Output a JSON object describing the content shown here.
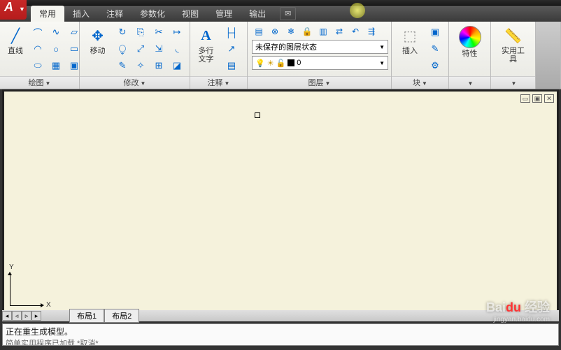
{
  "app": {
    "logo": "A"
  },
  "menubar": {
    "tabs": [
      "常用",
      "插入",
      "注释",
      "参数化",
      "视图",
      "管理",
      "输出"
    ],
    "mail_icon": "✉"
  },
  "ribbon": {
    "draw": {
      "title": "绘图",
      "line_label": "直线"
    },
    "modify": {
      "title": "修改",
      "move_label": "移动"
    },
    "annotate": {
      "title": "注释",
      "text_label": "多行\n文字"
    },
    "layers": {
      "title": "图层",
      "state": "未保存的图层状态",
      "current": "0"
    },
    "block": {
      "title": "块",
      "insert_label": "插入"
    },
    "prop": {
      "title": "特性"
    },
    "util": {
      "title": "实用工具"
    }
  },
  "layout": {
    "nav": [
      "◂",
      "◃",
      "▹",
      "▸"
    ],
    "tabs": [
      "布局1",
      "布局2"
    ]
  },
  "ucs": {
    "x": "X",
    "y": "Y"
  },
  "canvas_controls": [
    "▭",
    "▣",
    "✕"
  ],
  "command": {
    "line1": "正在重生成模型。",
    "line2": "简单实用程序已加载   *取消*"
  },
  "watermark": {
    "brand": "Bai",
    "brand2": "du",
    "suffix": "经验",
    "url": "jingyan.baidu.com"
  }
}
